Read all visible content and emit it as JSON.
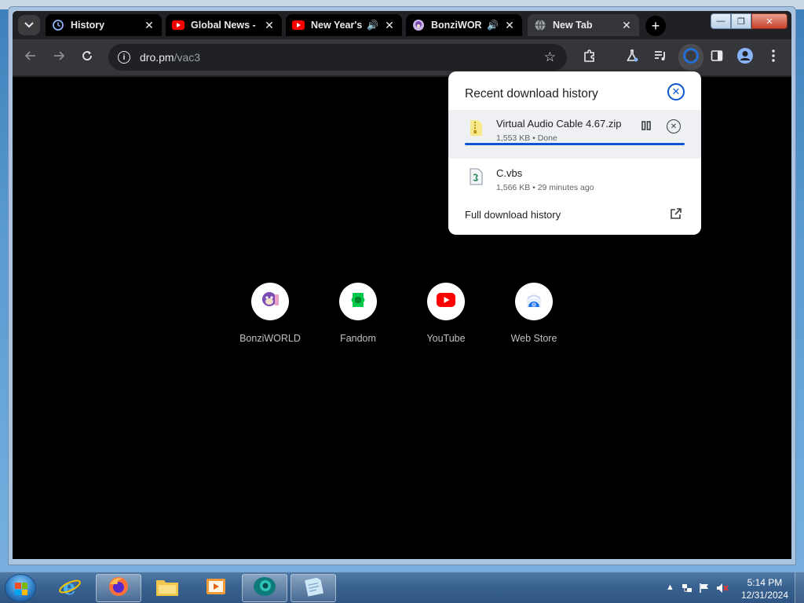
{
  "window": {
    "caption_minimize": "—",
    "caption_maximize": "❐",
    "caption_close": "✕"
  },
  "tabs": [
    {
      "title": "History",
      "icon": "history-icon",
      "audio": false,
      "active": false
    },
    {
      "title": "Global News - ",
      "icon": "youtube-icon",
      "audio": false,
      "active": false
    },
    {
      "title": "New Year's",
      "icon": "youtube-icon",
      "audio": true,
      "active": false
    },
    {
      "title": "BonziWOR",
      "icon": "bonzi-icon",
      "audio": true,
      "active": false
    },
    {
      "title": "New Tab",
      "icon": "globe-icon",
      "audio": false,
      "active": true
    }
  ],
  "toolbar": {
    "url_host": "dro.pm",
    "url_path": "/vac3",
    "info_glyph": "i"
  },
  "downloads": {
    "title": "Recent download history",
    "items": [
      {
        "name": "Virtual Audio Cable 4.67.zip",
        "meta": "1,553 KB • Done",
        "progress": 1.0
      },
      {
        "name": "C.vbs",
        "meta": "1,566 KB • 29 minutes ago"
      }
    ],
    "full_history_label": "Full download history"
  },
  "shortcuts": [
    {
      "label": "BonziWORLD",
      "icon": "bonzi-icon"
    },
    {
      "label": "Fandom",
      "icon": "fandom-icon"
    },
    {
      "label": "YouTube",
      "icon": "youtube-icon"
    },
    {
      "label": "Web Store",
      "icon": "webstore-icon"
    }
  ],
  "taskbar": {
    "time": "5:14 PM",
    "date": "12/31/2024",
    "apps": [
      "internet-explorer-icon",
      "firefox-icon",
      "file-explorer-icon",
      "media-player-icon",
      "chromium-icon",
      "notepad-icon"
    ]
  },
  "colors": {
    "accent": "#0b57d0",
    "youtube_red": "#ff0000",
    "fandom_green": "#00c94b"
  }
}
